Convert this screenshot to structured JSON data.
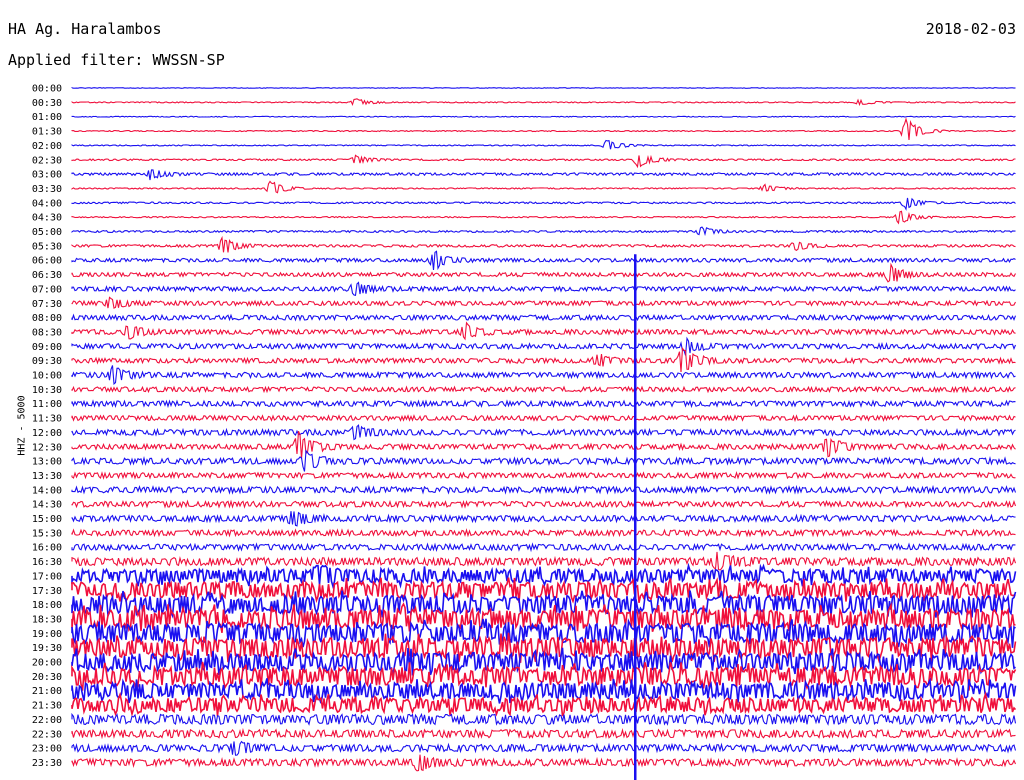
{
  "header": {
    "station": "HA Ag. Haralambos",
    "date": "2018-02-03",
    "filter": "Applied filter: WWSSN-SP"
  },
  "y_axis_label": "HHZ - 5000",
  "colors": {
    "odd": "#1a10f0",
    "even": "#f0103c",
    "marker": "#1a10f0"
  },
  "chart_data": {
    "type": "line",
    "title": "HA Ag. Haralambos",
    "ylabel": "HHZ - 5000",
    "rows": [
      "00:00",
      "00:30",
      "01:00",
      "01:30",
      "02:00",
      "02:30",
      "03:00",
      "03:30",
      "04:00",
      "04:30",
      "05:00",
      "05:30",
      "06:00",
      "06:30",
      "07:00",
      "07:30",
      "08:00",
      "08:30",
      "09:00",
      "09:30",
      "10:00",
      "10:30",
      "11:00",
      "11:30",
      "12:00",
      "12:30",
      "13:00",
      "13:30",
      "14:00",
      "14:30",
      "15:00",
      "15:30",
      "16:00",
      "16:30",
      "17:00",
      "17:30",
      "18:00",
      "18:30",
      "19:00",
      "19:30",
      "20:00",
      "20:30",
      "21:00",
      "21:30",
      "22:00",
      "22:30",
      "23:00",
      "23:30"
    ],
    "noise_level": [
      0.3,
      0.5,
      0.4,
      0.5,
      0.5,
      0.8,
      1.2,
      0.6,
      0.8,
      0.6,
      0.9,
      1.2,
      1.8,
      2.0,
      2.2,
      2.2,
      2.4,
      2.4,
      2.5,
      2.4,
      2.6,
      2.4,
      2.6,
      2.4,
      2.8,
      2.6,
      3.0,
      2.6,
      3.0,
      2.8,
      3.0,
      2.8,
      3.0,
      4.0,
      6.5,
      8.0,
      9.0,
      9.5,
      9.5,
      9.5,
      9.0,
      9.0,
      8.0,
      7.0,
      5.0,
      4.0,
      3.5,
      3.5
    ],
    "events": [
      {
        "row": 1,
        "minute": 9,
        "amp": 4
      },
      {
        "row": 1,
        "minute": 25,
        "amp": 3
      },
      {
        "row": 3,
        "minute": 26.5,
        "amp": 14
      },
      {
        "row": 4,
        "minute": 17,
        "amp": 6
      },
      {
        "row": 5,
        "minute": 18,
        "amp": 8
      },
      {
        "row": 5,
        "minute": 9,
        "amp": 5
      },
      {
        "row": 6,
        "minute": 2.5,
        "amp": 6
      },
      {
        "row": 7,
        "minute": 6.3,
        "amp": 8
      },
      {
        "row": 7,
        "minute": 22,
        "amp": 4
      },
      {
        "row": 8,
        "minute": 26.5,
        "amp": 6
      },
      {
        "row": 9,
        "minute": 26.3,
        "amp": 7
      },
      {
        "row": 10,
        "minute": 20,
        "amp": 5
      },
      {
        "row": 11,
        "minute": 4.8,
        "amp": 9
      },
      {
        "row": 11,
        "minute": 23,
        "amp": 5
      },
      {
        "row": 12,
        "minute": 11.5,
        "amp": 10
      },
      {
        "row": 13,
        "minute": 26,
        "amp": 9
      },
      {
        "row": 14,
        "minute": 9,
        "amp": 7
      },
      {
        "row": 15,
        "minute": 1.2,
        "amp": 6
      },
      {
        "row": 17,
        "minute": 12.5,
        "amp": 8
      },
      {
        "row": 17,
        "minute": 1.8,
        "amp": 7
      },
      {
        "row": 18,
        "minute": 19.5,
        "amp": 8
      },
      {
        "row": 19,
        "minute": 19.4,
        "amp": 14
      },
      {
        "row": 19,
        "minute": 16.7,
        "amp": 6
      },
      {
        "row": 20,
        "minute": 1.3,
        "amp": 9
      },
      {
        "row": 24,
        "minute": 9,
        "amp": 7
      },
      {
        "row": 25,
        "minute": 7.2,
        "amp": 14
      },
      {
        "row": 25,
        "minute": 24,
        "amp": 10
      },
      {
        "row": 26,
        "minute": 7.4,
        "amp": 9
      },
      {
        "row": 30,
        "minute": 7.0,
        "amp": 8
      },
      {
        "row": 33,
        "minute": 20.5,
        "amp": 9
      },
      {
        "row": 34,
        "minute": 7.8,
        "amp": 8
      },
      {
        "row": 46,
        "minute": 5.2,
        "amp": 7
      },
      {
        "row": 47,
        "minute": 11.0,
        "amp": 10
      }
    ],
    "marker_line": {
      "minute": 17.9,
      "from_row": 12,
      "to_row": 47
    }
  }
}
